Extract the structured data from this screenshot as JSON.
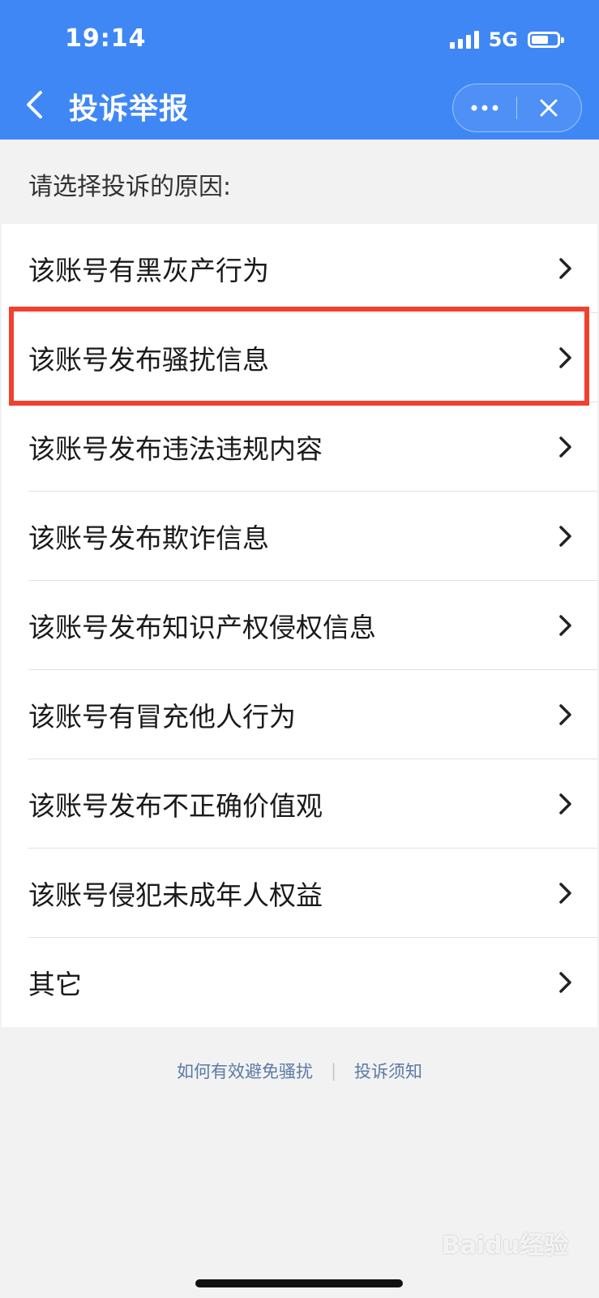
{
  "status_bar": {
    "time": "19:14",
    "network": "5G",
    "signal_bars": 4,
    "battery_level": 0.6
  },
  "header": {
    "title": "投诉举报",
    "back_icon": "chevron-left-icon",
    "more_icon": "more-dots-icon",
    "close_icon": "close-icon",
    "bg_color": "#3f87f5"
  },
  "prompt": "请选择投诉的原因:",
  "reasons": [
    {
      "label": "该账号有黑灰产行为"
    },
    {
      "label": "该账号发布骚扰信息"
    },
    {
      "label": "该账号发布违法违规内容"
    },
    {
      "label": "该账号发布欺诈信息"
    },
    {
      "label": "该账号发布知识产权侵权信息"
    },
    {
      "label": "该账号有冒充他人行为"
    },
    {
      "label": "该账号发布不正确价值观"
    },
    {
      "label": "该账号侵犯未成年人权益"
    },
    {
      "label": "其它"
    }
  ],
  "highlight_color": "#f04030",
  "footer": {
    "link1": "如何有效避免骚扰",
    "separator": "|",
    "link2": "投诉须知"
  },
  "watermark": "Baidu经验"
}
